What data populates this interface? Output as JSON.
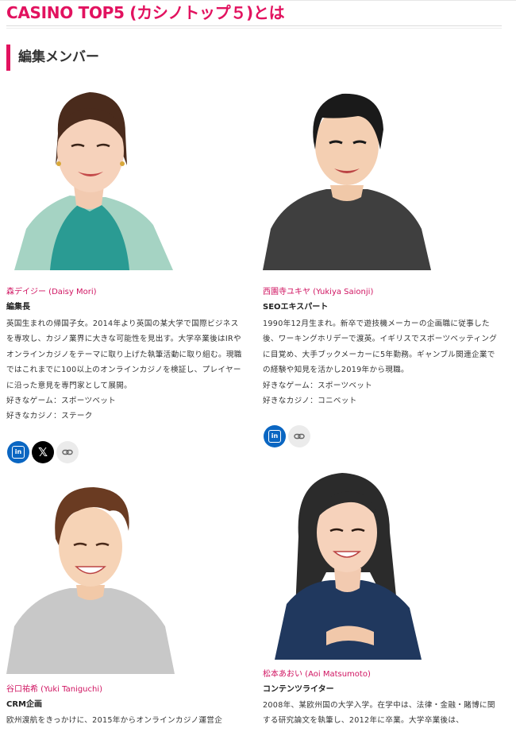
{
  "page": {
    "title": "CASINO TOP5 (カシノトップ５)とは"
  },
  "section": {
    "heading": "編集メンバー"
  },
  "members": [
    {
      "name": "森デイジー (Daisy Mori)",
      "role": "編集長",
      "bio": "英国生まれの帰国子女。2014年より英国の某大学で国際ビジネスを専攻し、カジノ業界に大きな可能性を見出す。大学卒業後はIRやオンラインカジノをテーマに取り上げた執筆活動に取り組む。現職ではこれまでに100以上のオンラインカジノを検証し、プレイヤーに沿った意見を専門家として展開。",
      "favorite_game": "好きなゲーム：スポーツベット",
      "favorite_casino": "好きなカジノ：ステーク",
      "socials": [
        "linkedin-icon",
        "x-icon",
        "link-icon"
      ]
    },
    {
      "name": "西園寺ユキヤ (Yukiya Saionji)",
      "role": "SEOエキスパート",
      "bio": "1990年12月生まれ。新卒で遊技機メーカーの企画職に従事した後、ワーキングホリデーで渡英。イギリスでスポーツベッティングに目覚め、大手ブックメーカーに5年勤務。ギャンブル関連企業での経験や知見を活かし2019年から現職。",
      "favorite_game": "好きなゲーム：スポーツベット",
      "favorite_casino": "好きなカジノ：コニベット",
      "socials": [
        "linkedin-icon",
        "link-icon"
      ]
    },
    {
      "name": "谷口祐希 (Yuki Taniguchi)",
      "role": "CRM企画",
      "bio": "欧州渡航をきっかけに、2015年からオンラインカジノ運営企"
    },
    {
      "name": "松本あおい (Aoi Matsumoto)",
      "role": "コンテンツライター",
      "bio": "2008年、某欧州国の大学入学。在学中は、法律・金融・賭博に関する研究論文を執筆し、2012年に卒業。大学卒業後は、"
    }
  ],
  "colors": {
    "accent": "#e2125f",
    "name": "#d01461",
    "linkedin": "#0a66c2"
  }
}
